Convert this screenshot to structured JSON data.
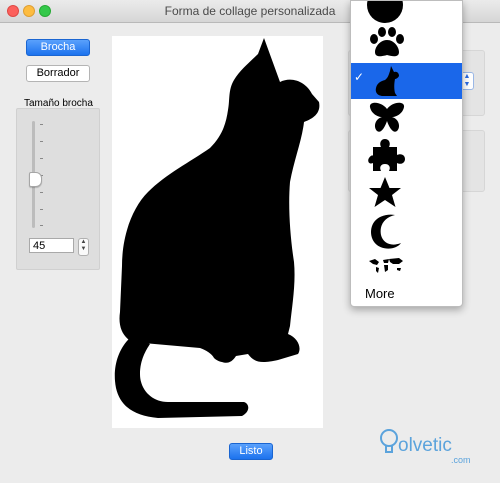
{
  "window": {
    "title": "Forma de collage personalizada"
  },
  "toolbar": {
    "brush_label": "Brocha",
    "eraser_label": "Borrador"
  },
  "brush": {
    "label": "Tamaño brocha",
    "size_value": "45",
    "slider_level": 0.45
  },
  "footer": {
    "done_label": "Listo"
  },
  "shape_menu": {
    "items": [
      {
        "icon": "circle-icon"
      },
      {
        "icon": "paw-icon"
      },
      {
        "icon": "cat-icon",
        "selected": true
      },
      {
        "icon": "butterfly-icon"
      },
      {
        "icon": "puzzle-icon"
      },
      {
        "icon": "star-icon"
      },
      {
        "icon": "moon-icon"
      },
      {
        "icon": "world-map-icon"
      }
    ],
    "check_mark": "✓",
    "more_label": "More"
  },
  "watermark": {
    "brand_text": "olvetic",
    "domain": ".com"
  },
  "colors": {
    "accent": "#1a67ea",
    "primary_button": "#2a7bf0",
    "watermark": "#5ba3dc"
  }
}
